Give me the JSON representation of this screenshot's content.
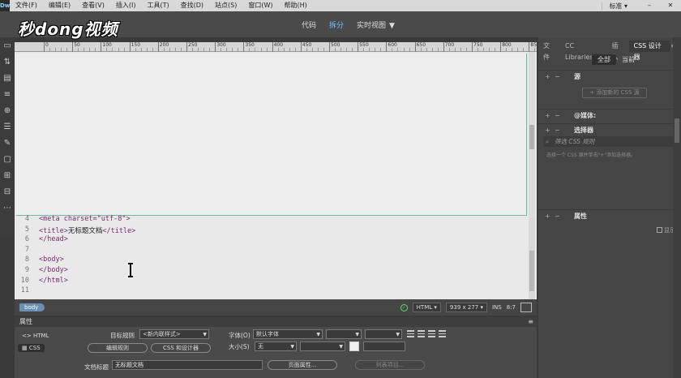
{
  "app": {
    "logo": "Dw"
  },
  "menu": [
    "文件(F)",
    "编辑(E)",
    "查看(V)",
    "插入(I)",
    "工具(T)",
    "查找(D)",
    "站点(S)",
    "窗口(W)",
    "帮助(H)"
  ],
  "menu_right": {
    "workspace": "标准",
    "workspace_caret": "▾",
    "minimize": "–",
    "close": "✕"
  },
  "watermark": "秒dong视频",
  "view_tabs": {
    "code": "代码",
    "split": "拆分",
    "live": "实时视图",
    "live_caret": "▼"
  },
  "ruler_labels": [
    "0",
    "50",
    "100",
    "150",
    "200",
    "250",
    "300",
    "350",
    "400",
    "450",
    "500",
    "550",
    "600",
    "650",
    "700",
    "750",
    "800",
    "850",
    "900",
    "950"
  ],
  "code": {
    "lines": [
      {
        "num": "4",
        "pre": "<meta charset=\"utf-8\">",
        "text": "",
        "post": ""
      },
      {
        "num": "5",
        "pre": "<title>",
        "text": "无标题文档",
        "post": "</title>"
      },
      {
        "num": "6",
        "pre": "</head>",
        "text": "",
        "post": ""
      },
      {
        "num": "7",
        "pre": "",
        "text": "",
        "post": ""
      },
      {
        "num": "8",
        "pre": "<body>",
        "text": "",
        "post": ""
      },
      {
        "num": "9",
        "pre": "</body>",
        "text": "",
        "post": ""
      },
      {
        "num": "10",
        "pre": "</html>",
        "text": "",
        "post": ""
      },
      {
        "num": "11",
        "pre": "",
        "text": "",
        "post": ""
      }
    ]
  },
  "status": {
    "tag": "body",
    "doctype": "HTML",
    "size": "939 x 277",
    "mode": "INS",
    "position": "8:7"
  },
  "properties": {
    "title": "属性",
    "html_tab": "HTML",
    "css_tab": "CSS",
    "target_rule_label": "目标规则",
    "target_rule_value": "<新内联样式>",
    "edit_rule": "编辑规则",
    "css_designer": "CSS 和设计器",
    "font_label": "字体(O)",
    "font_value": "默认字体",
    "size_label": "大小(S)",
    "size_value": "无",
    "doc_title_label": "文档标题",
    "doc_title_value": "无标题文档",
    "page_props": "页面属性...",
    "list_item": "列表项目..."
  },
  "right_panel": {
    "tabs": [
      "文件",
      "CC Libraries",
      "插入",
      "CSS 设计器"
    ],
    "seg_all": "全部",
    "seg_current": "当前",
    "source": "源",
    "add_css_source": "+ 添加新的 CSS 源",
    "media": "@媒体:",
    "selectors": "选择器",
    "filter_placeholder": "筛选 CSS 规则",
    "selector_hint": "选择一个 CSS 源并单击\"+\"添加选择器。",
    "properties": "属性",
    "show_set": "显示"
  }
}
